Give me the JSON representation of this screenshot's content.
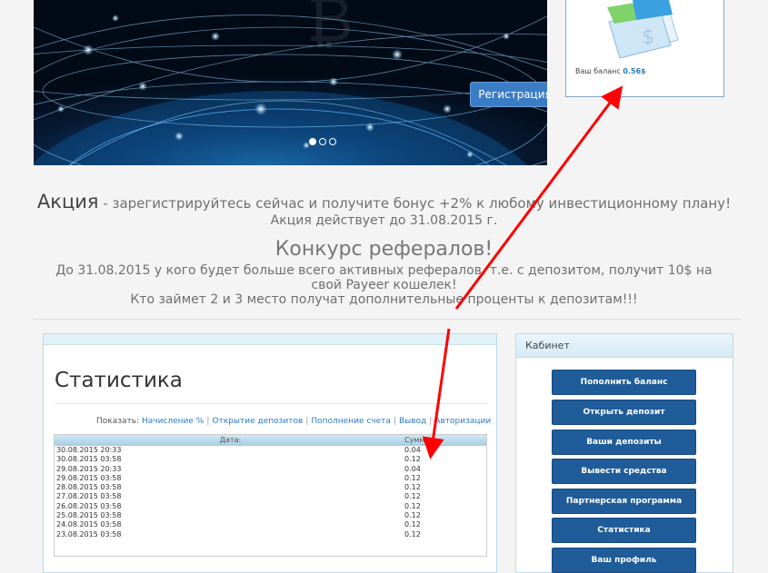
{
  "banner": {
    "register_label": "Регистрация",
    "slides": 3,
    "active_slide": 1
  },
  "balance": {
    "label": "Ваш баланс",
    "value": "0.56$"
  },
  "promo": {
    "title_big": "Акция",
    "title_rest": " - зарегистрируйтесь сейчас и получите бонус +2% к любому инвестиционному плану!",
    "date_note": "Акция действует до 31.08.2015 г.",
    "contest_title": "Конкурс рефералов!",
    "contest_line1": "До 31.08.2015 у кого будет больше всего активных рефералов, т.е. с депозитом, получит 10$ на",
    "contest_line2": "свой Payeer кошелек!",
    "contest_line3": "Кто займет 2 и 3 место получат дополнительные проценты к депозитам!!!"
  },
  "stats": {
    "title": "Статистика",
    "show_label": "Показать:",
    "filters": [
      "Начисление %",
      "Открытие депозитов",
      "Пополнение счета",
      "Вывод",
      "Авторизации"
    ],
    "col_date": "Дата:",
    "col_sum": "Сумма:",
    "rows": [
      {
        "date": "30.08.2015 20:33",
        "sum": "0.04"
      },
      {
        "date": "30.08.2015 03:58",
        "sum": "0.12"
      },
      {
        "date": "29.08.2015 20:33",
        "sum": "0.04"
      },
      {
        "date": "29.08.2015 03:58",
        "sum": "0.12"
      },
      {
        "date": "28.08.2015 03:58",
        "sum": "0.12"
      },
      {
        "date": "27.08.2015 03:58",
        "sum": "0.12"
      },
      {
        "date": "26.08.2015 03:58",
        "sum": "0.12"
      },
      {
        "date": "25.08.2015 03:58",
        "sum": "0.12"
      },
      {
        "date": "24.08.2015 03:58",
        "sum": "0.12"
      },
      {
        "date": "23.08.2015 03:58",
        "sum": "0.12"
      }
    ]
  },
  "cabinet": {
    "title": "Кабинет",
    "buttons": [
      "Пополнить баланс",
      "Открыть депозит",
      "Ваши депозиты",
      "Вывести средства",
      "Партнерская программа",
      "Статистика",
      "Ваш профиль"
    ]
  },
  "colors": {
    "accent": "#2c7bbf",
    "button": "#1f5c99",
    "annotation_arrow": "#ff0000"
  },
  "icons": [
    "credit-card-icon",
    "dollar-icon"
  ]
}
